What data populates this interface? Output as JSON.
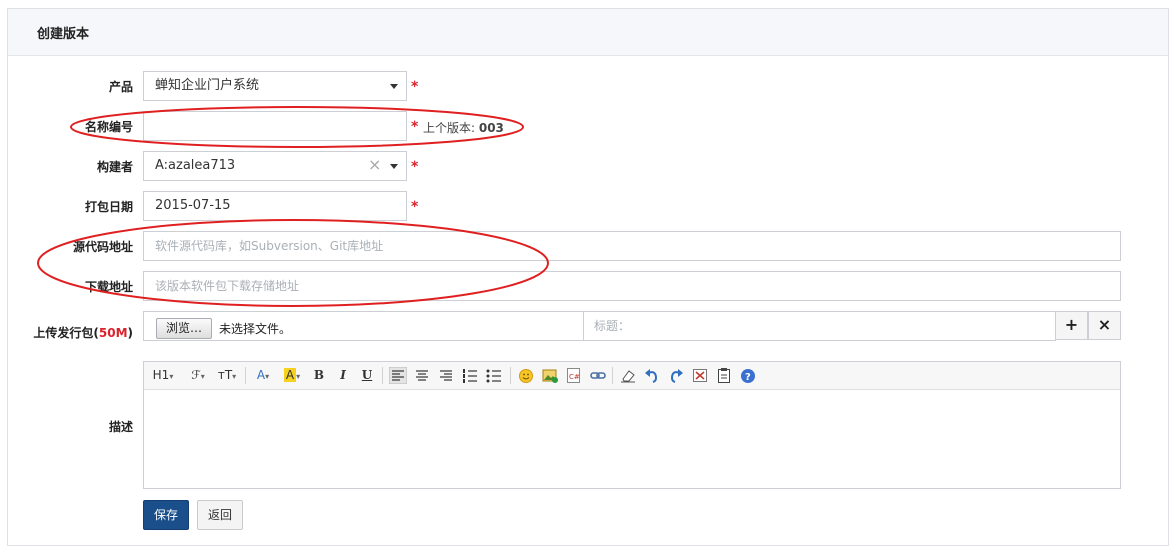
{
  "page": {
    "title": "创建版本"
  },
  "form": {
    "product": {
      "label": "产品",
      "value": "蝉知企业门户系统"
    },
    "name": {
      "label": "名称编号",
      "value": "",
      "hint_prefix": "上个版本: ",
      "hint_value": "003"
    },
    "builder": {
      "label": "构建者",
      "value": "A:azalea713",
      "clear_icon": "×"
    },
    "date": {
      "label": "打包日期",
      "value": "2015-07-15"
    },
    "scm": {
      "label": "源代码地址",
      "placeholder": "软件源代码库，如Subversion、Git库地址"
    },
    "download": {
      "label": "下载地址",
      "placeholder": "该版本软件包下载存储地址"
    },
    "upload": {
      "label_prefix": "上传发行包(",
      "label_size": "50M",
      "label_suffix": ")",
      "browse_label": "浏览…",
      "no_file_text": "未选择文件。",
      "title_placeholder": "标题：",
      "add_icon": "+",
      "remove_icon": "×"
    },
    "desc": {
      "label": "描述"
    },
    "required_mark": "*"
  },
  "editor": {
    "toolbar": {
      "heading": "H1",
      "font": "ℱ",
      "size": "тT",
      "forecolor": "A",
      "hilite": "A",
      "bold": "B",
      "italic": "I",
      "underline": "U",
      "emoticon_icon": "smiley-icon",
      "image_icon": "image-icon",
      "code_icon": "code-icon",
      "link_icon": "link-icon",
      "eraser_icon": "eraser-icon",
      "undo_icon": "undo-icon",
      "redo_icon": "redo-icon",
      "fullscreen_icon": "fullscreen-icon",
      "source_icon": "clipboard-icon",
      "help_icon": "help-icon",
      "code_text": "C#",
      "help_text": "?"
    }
  },
  "buttons": {
    "save": "保存",
    "back": "返回"
  },
  "colors": {
    "accent": "#1b4f8c",
    "required": "#d9232c",
    "annotation": "#e02020"
  }
}
